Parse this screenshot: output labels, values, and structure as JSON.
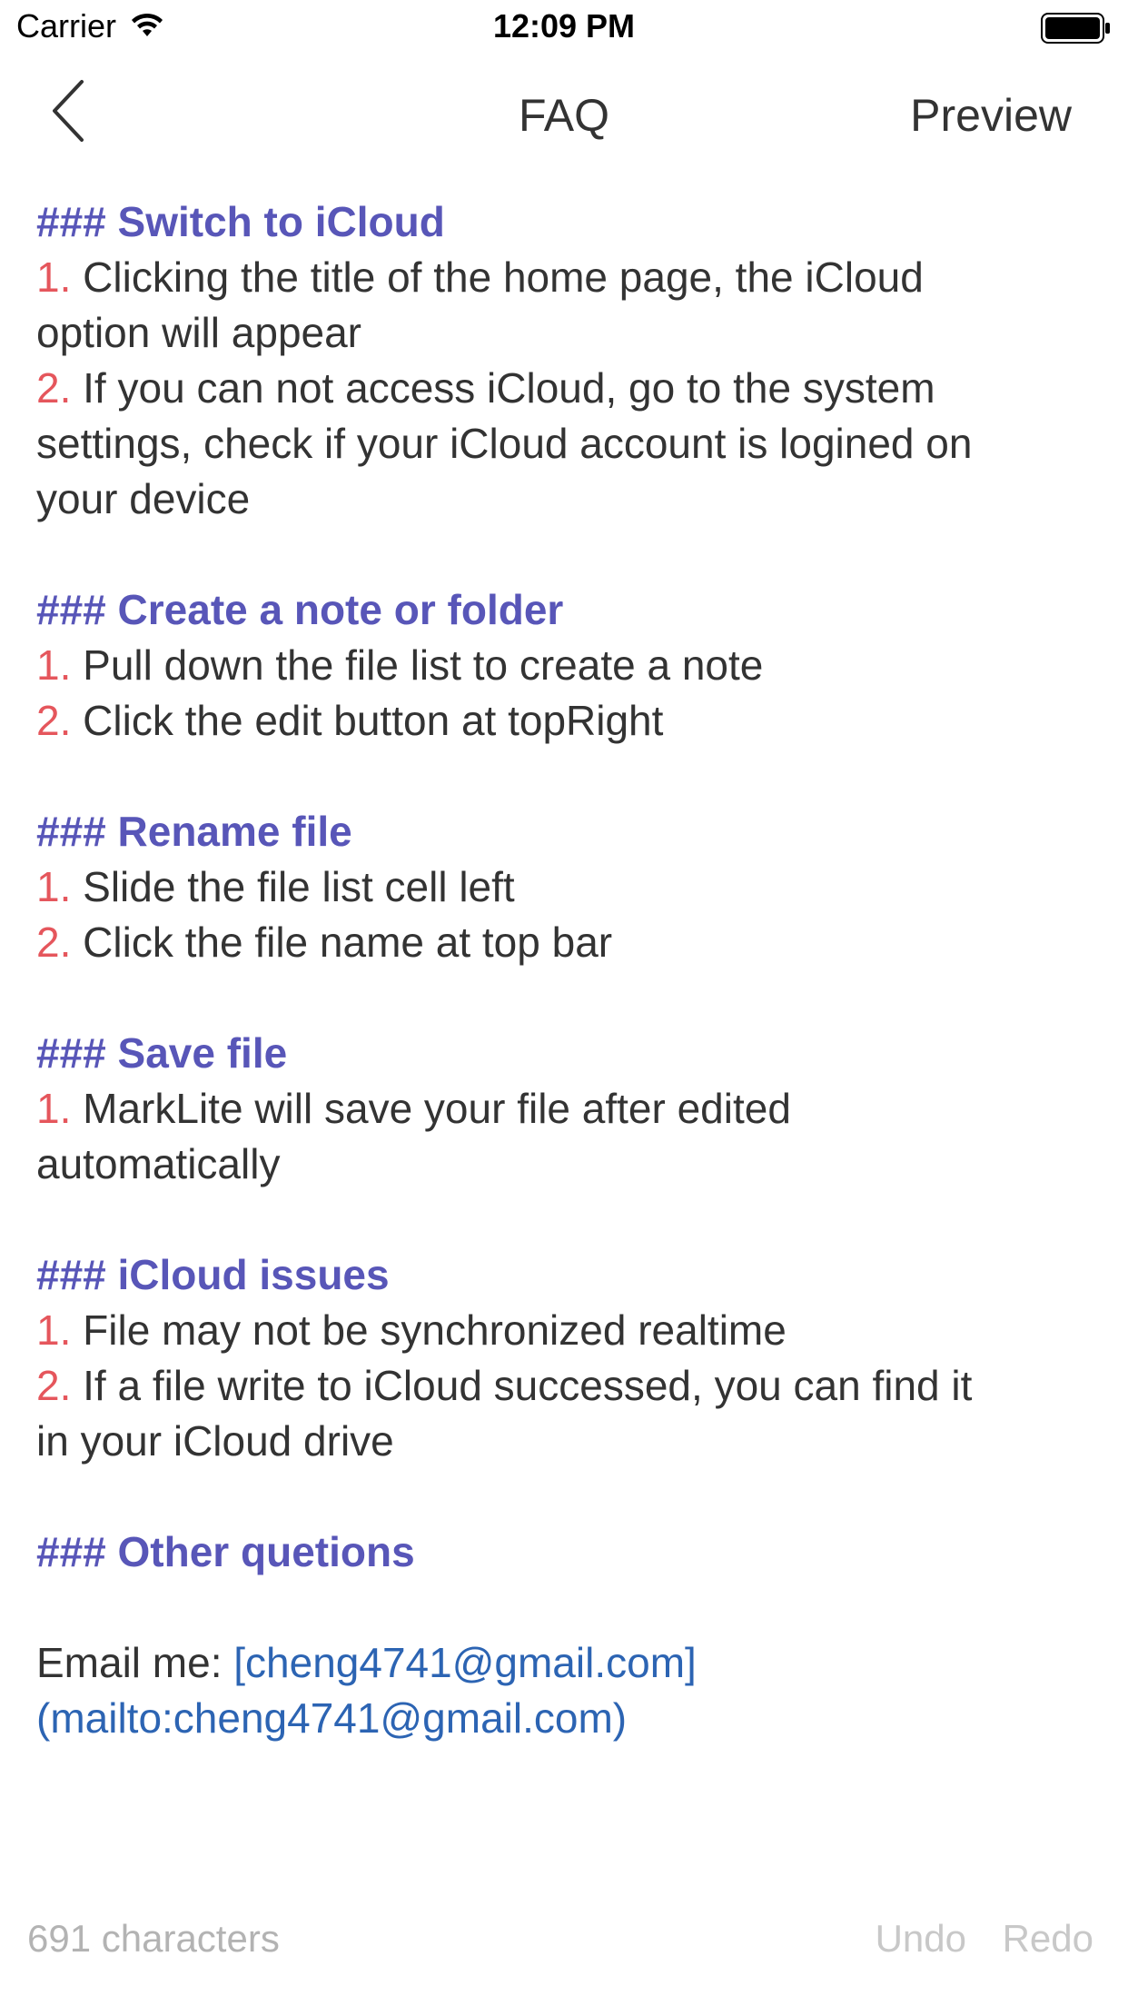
{
  "status_bar": {
    "carrier": "Carrier",
    "time": "12:09 PM"
  },
  "nav": {
    "title": "FAQ",
    "preview_label": "Preview"
  },
  "content": {
    "s1_heading": "### Switch to iCloud",
    "s1_item1_num": "1.",
    "s1_item1_line1": " Clicking the title of the home page, the iCloud",
    "s1_item1_line2": "option will appear",
    "s1_item2_num": "2.",
    "s1_item2_line1": " If you can not access iCloud, go to the system",
    "s1_item2_line2": "settings, check if your iCloud account is logined on",
    "s1_item2_line3": "your device",
    "s2_heading": "### Create a note or folder",
    "s2_item1_num": "1.",
    "s2_item1_text": " Pull down the file list to create a note",
    "s2_item2_num": "2.",
    "s2_item2_text": " Click the edit button at topRight",
    "s3_heading": "### Rename file",
    "s3_item1_num": "1.",
    "s3_item1_text": " Slide the file list cell left",
    "s3_item2_num": "2.",
    "s3_item2_text": " Click the file name at top bar",
    "s4_heading": "### Save file",
    "s4_item1_num": "1.",
    "s4_item1_line1": " MarkLite will save your file after edited",
    "s4_item1_line2": "automatically",
    "s5_heading": "### iCloud issues",
    "s5_item1_num": "1.",
    "s5_item1_text": " File may not be synchronized realtime",
    "s5_item2_num": "2.",
    "s5_item2_line1": " If a file write to iCloud successed, you can find it",
    "s5_item2_line2": "in your iCloud drive",
    "s6_heading": "### Other quetions",
    "email_prefix": "Email me: ",
    "email_link_line1": "[cheng4741@gmail.com]",
    "email_link_line2": "(mailto:cheng4741@gmail.com)"
  },
  "bottom_bar": {
    "char_count": "691 characters",
    "undo_label": "Undo",
    "redo_label": "Redo"
  },
  "colors": {
    "heading": "#5856b8",
    "list_number": "#e5565c",
    "link": "#2c64b3",
    "body_text": "#333333",
    "disabled_text": "#b3b3b3"
  }
}
